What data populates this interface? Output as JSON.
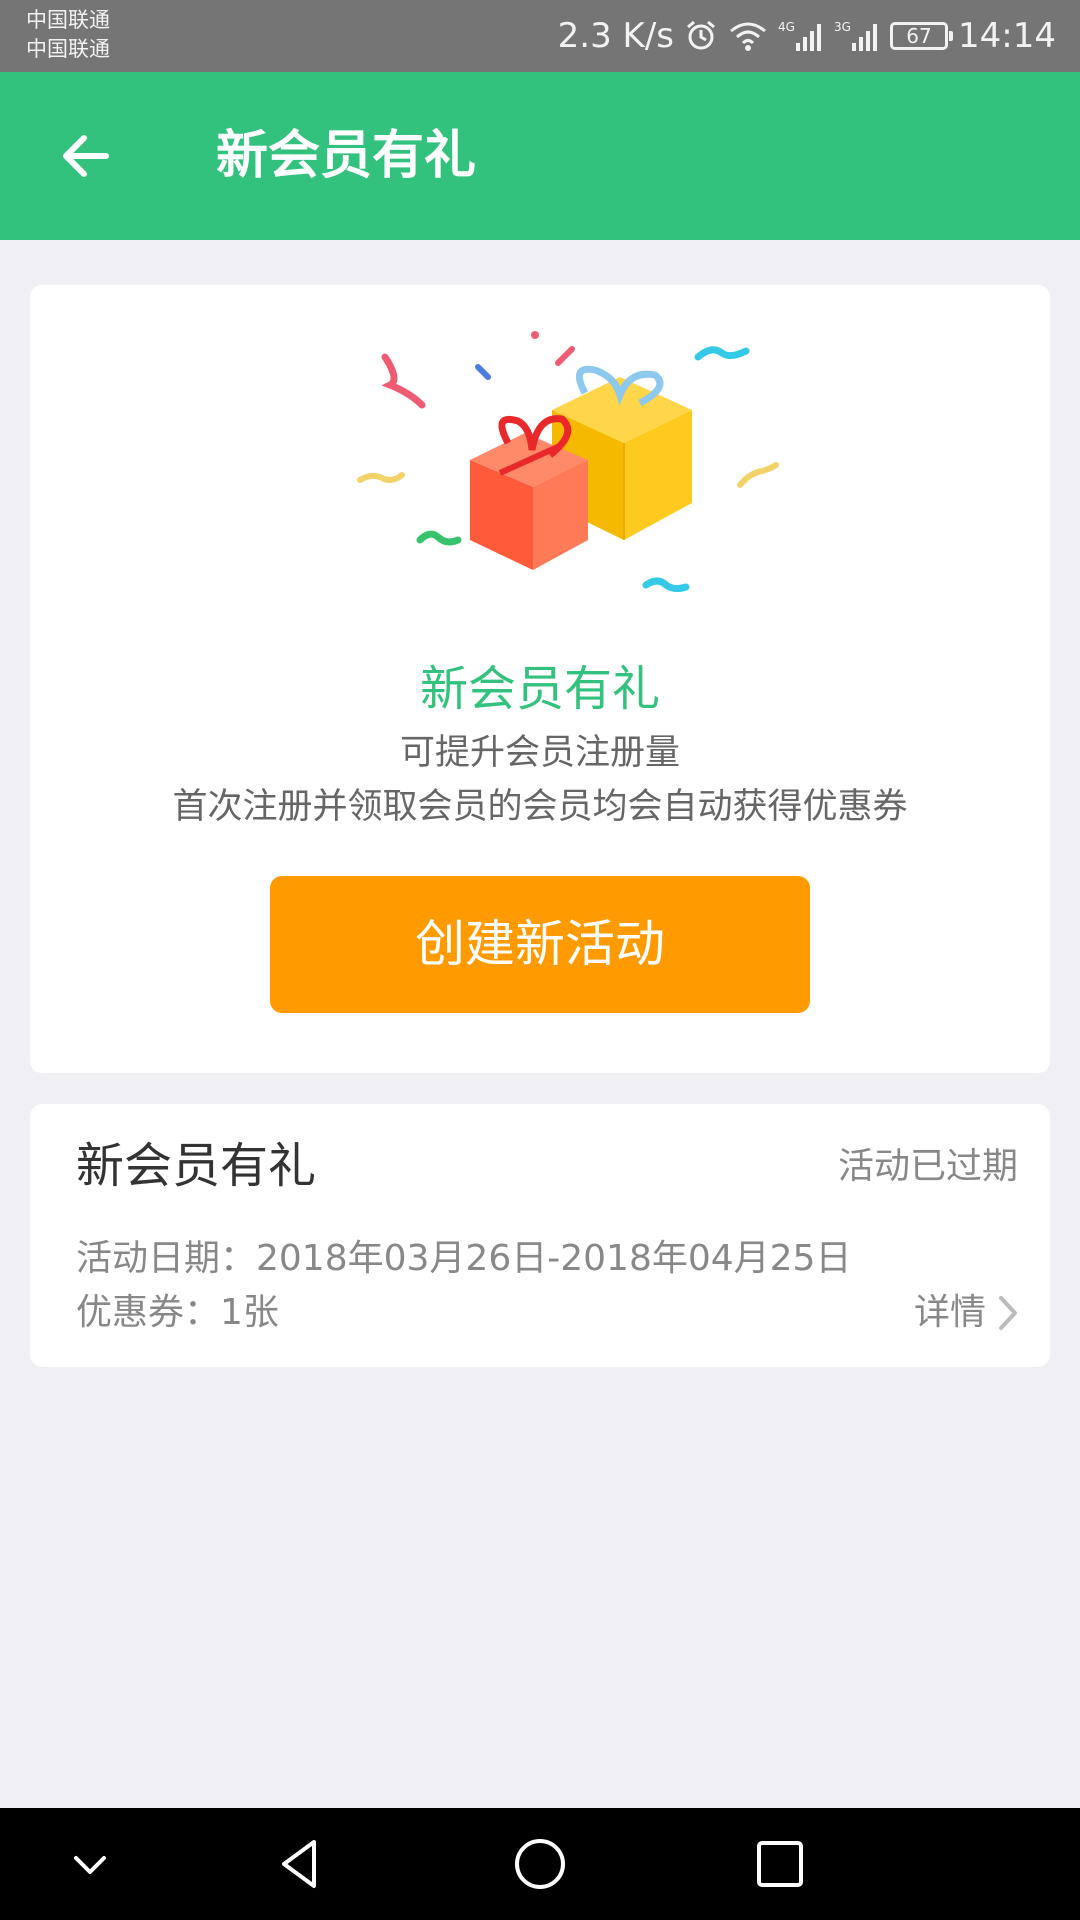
{
  "status_bar": {
    "carrier_1": "中国联通",
    "carrier_2": "中国联通",
    "network_speed": "2.3 K/s",
    "network_4g": "4G",
    "network_3g": "3G",
    "battery_level": "67",
    "time": "14:14",
    "icons": [
      "alarm-icon",
      "wifi-icon",
      "signal-4g-icon",
      "signal-3g-icon",
      "battery-icon"
    ]
  },
  "app_bar": {
    "title": "新会员有礼",
    "back_icon": "arrow-left-icon",
    "color": "#33c27e"
  },
  "hero": {
    "illustration": "gift-boxes-illustration",
    "title": "新会员有礼",
    "desc_line1": "可提升会员注册量",
    "desc_line2": "首次注册并领取会员的会员均会自动获得优惠券",
    "create_button_label": "创建新活动",
    "button_color": "#ff9a00"
  },
  "activities": [
    {
      "title": "新会员有礼",
      "status": "活动已过期",
      "dates": "活动日期：2018年03月26日-2018年04月25日",
      "coupons": "优惠券：1张",
      "details_label": "详情"
    }
  ],
  "nav_bar": {
    "icons": [
      "chevron-down-icon",
      "back-triangle-icon",
      "home-circle-icon",
      "recents-square-icon"
    ]
  }
}
